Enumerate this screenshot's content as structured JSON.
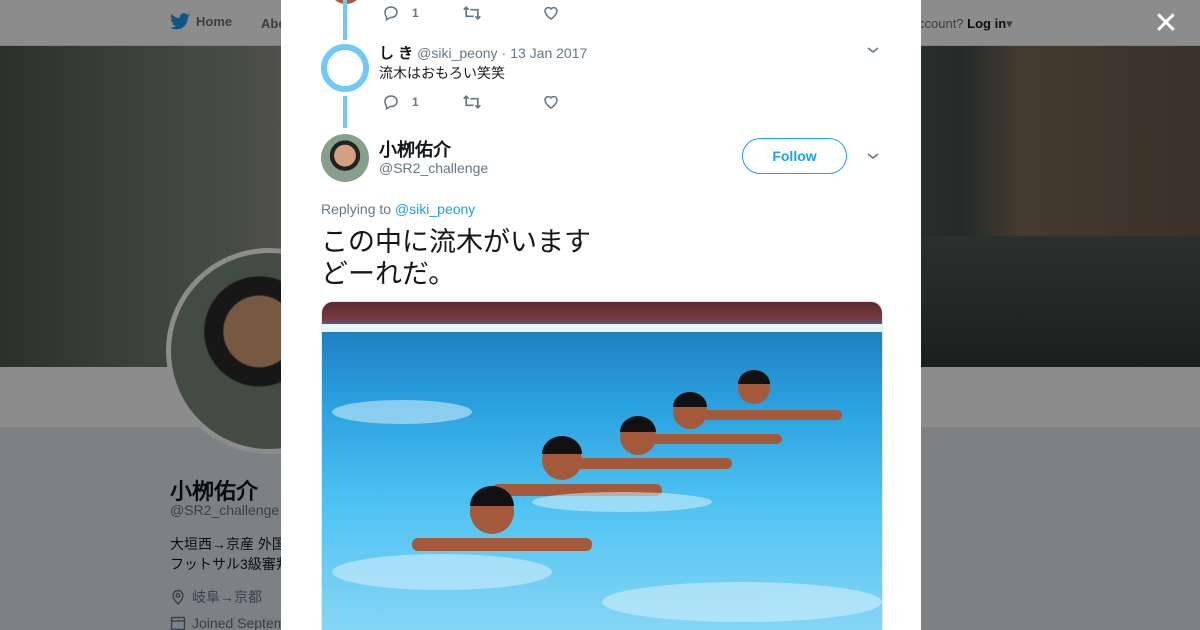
{
  "topbar": {
    "home_label": "Home",
    "about_label": "Abo",
    "account_prompt": "ccount?",
    "login_label": "Log in"
  },
  "profile": {
    "name": "小栁佑介",
    "handle": "@SR2_challenge",
    "bio_line1": "大垣西→京産 外国",
    "bio_line2": "フットサル3級審判",
    "location": "岐阜→京都",
    "joined": "Joined Septem"
  },
  "modal": {
    "prev_tweet_actions": {
      "reply_count": "1"
    },
    "reply_tweet": {
      "name": "し き",
      "handle": "@siki_peony",
      "separator": "·",
      "date": "13 Jan 2017",
      "text": "流木はおもろい笑笑",
      "reply_count": "1"
    },
    "main_tweet": {
      "name": "小栁佑介",
      "handle": "@SR2_challenge",
      "follow_label": "Follow",
      "replying_prefix": "Replying to",
      "replying_to": "@siki_peony",
      "text_line1": "この中に流木がいます",
      "text_line2": "どーれだ。"
    }
  },
  "colors": {
    "accent": "#1da1f2",
    "thread_line": "#71c9f8",
    "muted": "#657786"
  },
  "icons": [
    "twitter-bird-icon",
    "reply-icon",
    "retweet-icon",
    "like-icon",
    "chevron-down-icon",
    "close-icon",
    "location-icon",
    "calendar-icon"
  ]
}
